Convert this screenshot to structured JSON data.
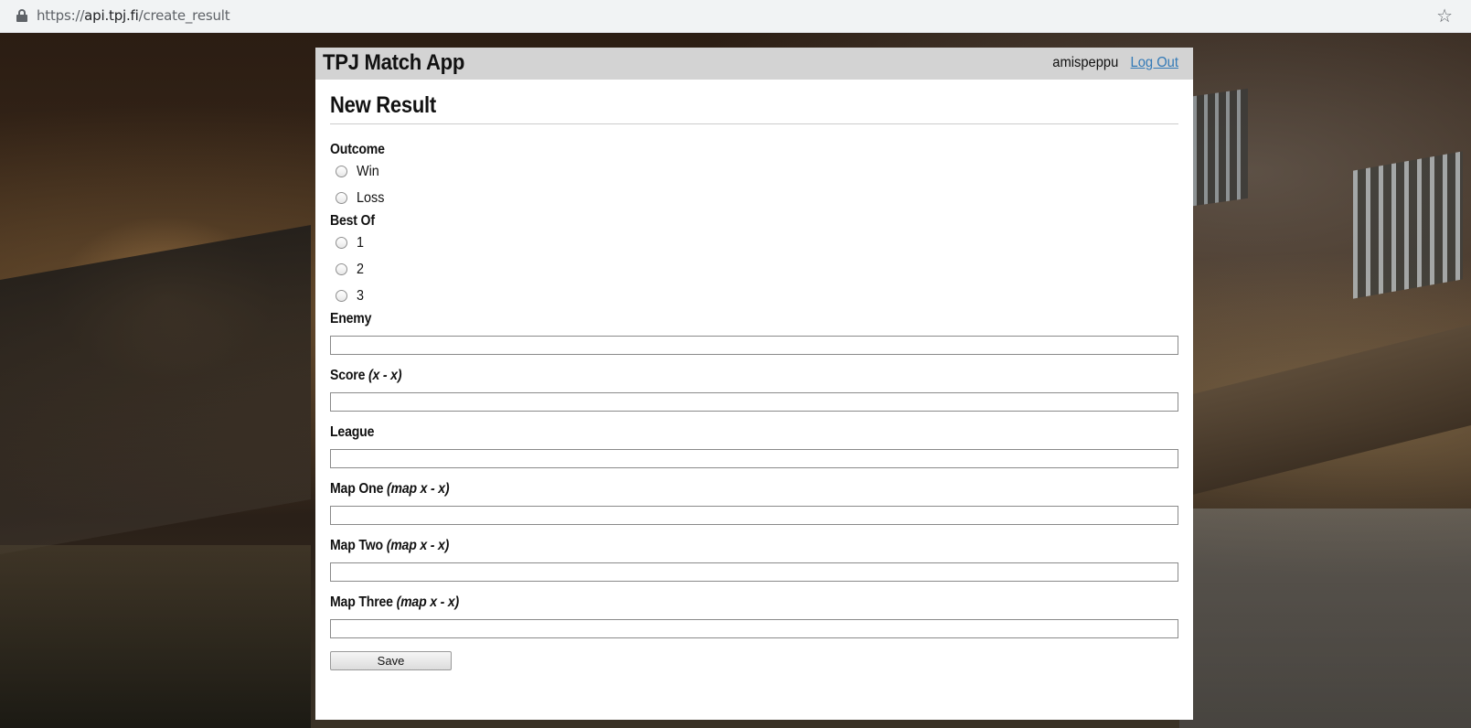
{
  "browser": {
    "url_scheme": "https://",
    "url_host": "api.tpj.fi",
    "url_path": "/create_result"
  },
  "header": {
    "brand": "TPJ Match App",
    "username": "amispeppu",
    "logout_label": "Log Out"
  },
  "page": {
    "title": "New Result"
  },
  "form": {
    "outcome": {
      "label": "Outcome",
      "options": [
        "Win",
        "Loss"
      ]
    },
    "best_of": {
      "label": "Best Of",
      "options": [
        "1",
        "2",
        "3"
      ]
    },
    "enemy": {
      "label": "Enemy",
      "hint": "",
      "value": ""
    },
    "score": {
      "label": "Score",
      "hint": "(x - x)",
      "value": ""
    },
    "league": {
      "label": "League",
      "hint": "",
      "value": ""
    },
    "map_one": {
      "label": "Map One",
      "hint": "(map x - x)",
      "value": ""
    },
    "map_two": {
      "label": "Map Two",
      "hint": "(map x - x)",
      "value": ""
    },
    "map_three": {
      "label": "Map Three",
      "hint": "(map x - x)",
      "value": ""
    },
    "save_label": "Save"
  },
  "colors": {
    "topbar": "#d3d3d3",
    "link": "#337ab7"
  }
}
